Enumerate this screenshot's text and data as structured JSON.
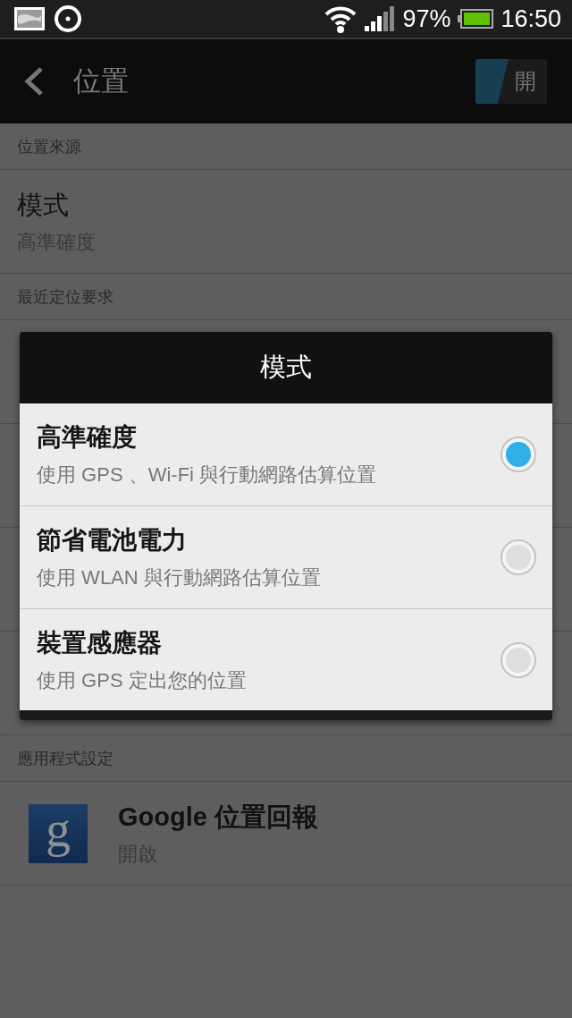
{
  "status_bar": {
    "battery_text": "97%",
    "time": "16:50"
  },
  "action_bar": {
    "title": "位置",
    "toggle": {
      "label": "開",
      "on": true
    }
  },
  "sections": [
    {
      "header": "位置來源",
      "rows": [
        {
          "title": "模式",
          "summary": "高準確度"
        }
      ]
    },
    {
      "header": "最近定位要求",
      "kind": "covered"
    },
    {
      "header": "應用程式設定",
      "rows": [
        {
          "title": "Google 位置回報",
          "summary": "開啟",
          "icon": {
            "kind": "app",
            "letter": "g"
          }
        }
      ]
    }
  ],
  "dialog": {
    "title": "模式",
    "options": [
      {
        "label": "高準確度",
        "description": "使用 GPS 、Wi-Fi 與行動網路估算位置",
        "selected": true
      },
      {
        "label": "節省電池電力",
        "description": "使用 WLAN 與行動網路估算位置",
        "selected": false
      },
      {
        "label": "裝置感應器",
        "description": "使用 GPS 定出您的位置",
        "selected": false
      }
    ]
  }
}
